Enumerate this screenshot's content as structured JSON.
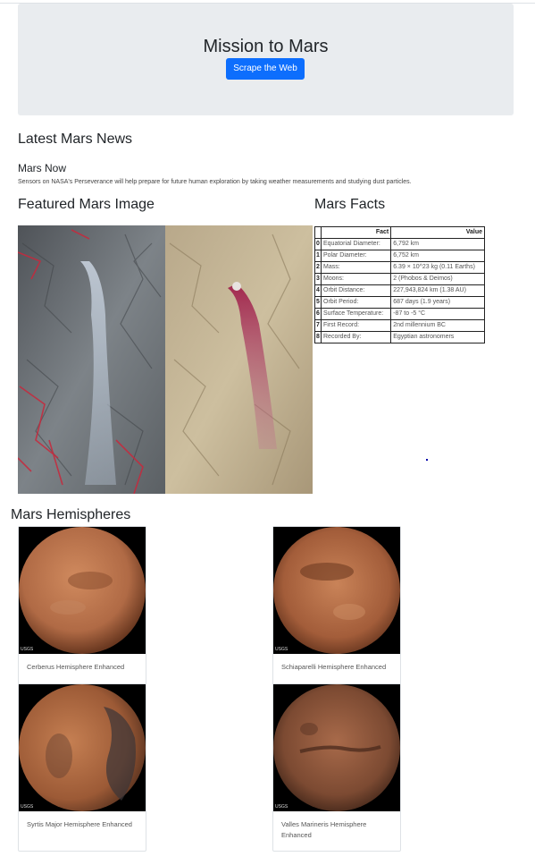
{
  "header": {
    "title": "Mission to Mars",
    "scrape_button": "Scrape the Web"
  },
  "news": {
    "section_title": "Latest Mars News",
    "headline": "Mars Now",
    "paragraph": "Sensors on NASA's Perseverance will help prepare for future human exploration by taking weather measurements and studying dust particles."
  },
  "featured": {
    "section_title": "Featured Mars Image"
  },
  "facts": {
    "section_title": "Mars Facts",
    "columns": [
      "Fact",
      "Value"
    ],
    "rows": [
      {
        "index": "0",
        "fact": "Equatorial Diameter:",
        "value": "6,792 km"
      },
      {
        "index": "1",
        "fact": "Polar Diameter:",
        "value": "6,752 km"
      },
      {
        "index": "2",
        "fact": "Mass:",
        "value": "6.39 × 10^23 kg (0.11 Earths)"
      },
      {
        "index": "3",
        "fact": "Moons:",
        "value": "2 (Phobos & Deimos)"
      },
      {
        "index": "4",
        "fact": "Orbit Distance:",
        "value": "227,943,824 km (1.38 AU)"
      },
      {
        "index": "5",
        "fact": "Orbit Period:",
        "value": "687 days (1.9 years)"
      },
      {
        "index": "6",
        "fact": "Surface Temperature:",
        "value": "-87 to -5 °C"
      },
      {
        "index": "7",
        "fact": "First Record:",
        "value": "2nd millennium BC"
      },
      {
        "index": "8",
        "fact": "Recorded By:",
        "value": "Egyptian astronomers"
      }
    ]
  },
  "hemispheres": {
    "section_title": "Mars Hemispheres",
    "items": [
      {
        "caption": "Cerberus Hemisphere Enhanced"
      },
      {
        "caption": "Schiaparelli Hemisphere Enhanced"
      },
      {
        "caption": "Syrtis Major Hemisphere Enhanced"
      },
      {
        "caption": "Valles Marineris Hemisphere Enhanced"
      }
    ],
    "logo_text": "USGS"
  }
}
